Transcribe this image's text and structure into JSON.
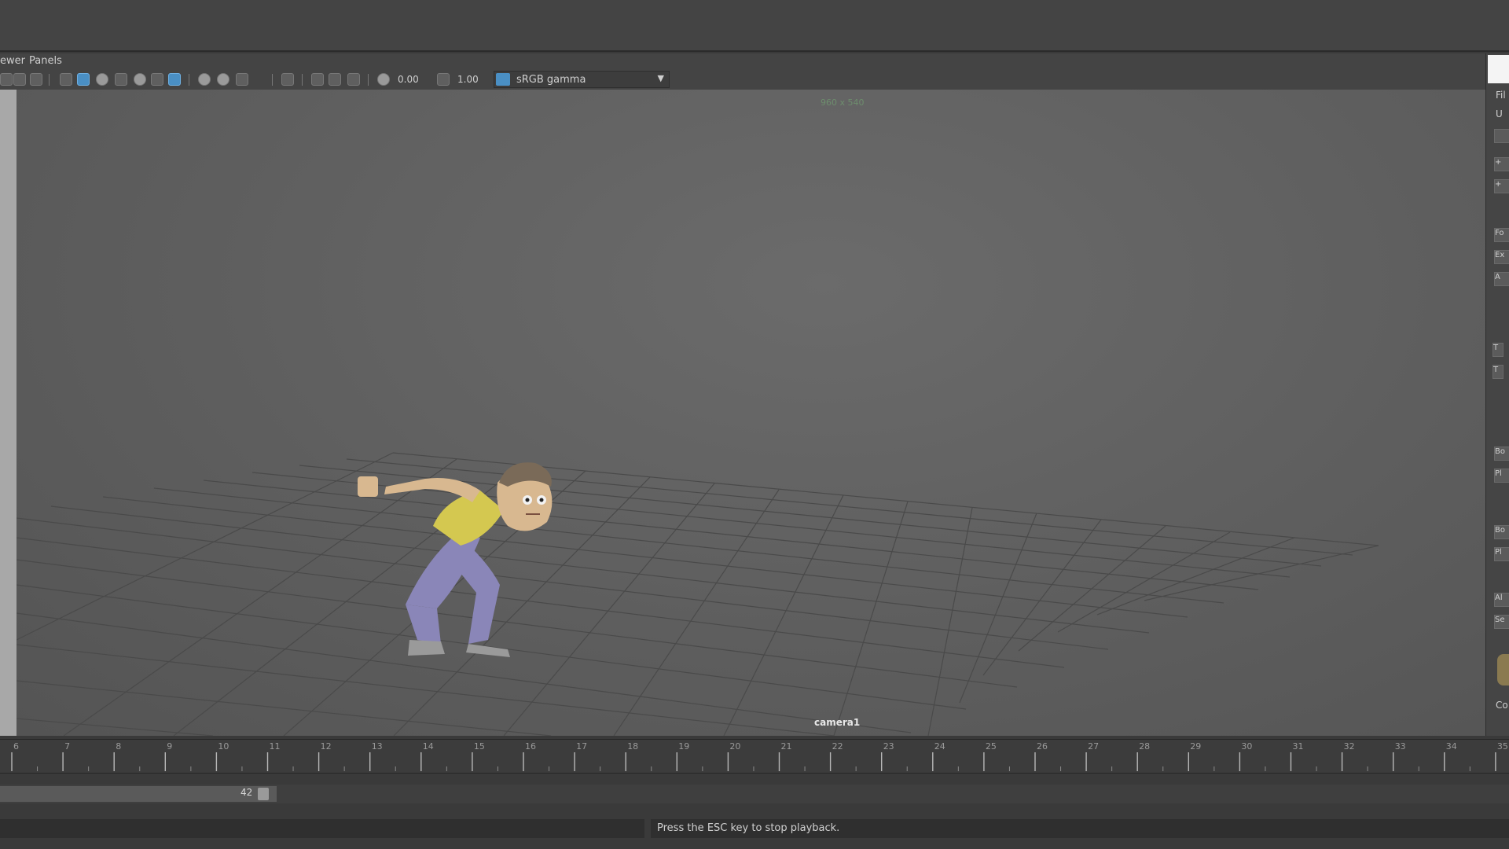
{
  "menu": {
    "item1": "ewer",
    "item2": "Panels"
  },
  "toolbar": {
    "exposure": "0.00",
    "gamma": "1.00",
    "color_space": "sRGB gamma",
    "icons": [
      "select-camera-icon",
      "camera-attributes-icon",
      "bookmark-icon",
      "image-plane-icon",
      "grid-icon",
      "film-gate-icon",
      "wireframe-icon",
      "smooth-shade-icon",
      "textured-icon",
      "lighting-icon",
      "shadows-icon",
      "ambient-occlusion-icon",
      "motion-blur-icon",
      "antialiasing-icon",
      "depth-of-field-icon",
      "isolate-select-icon",
      "xray-icon",
      "xray-joints-icon",
      "backface-icon",
      "exposure-icon",
      "gamma-icon",
      "color-management-icon"
    ]
  },
  "viewport": {
    "resolution_gate": "960 x 540",
    "camera_name": "camera1"
  },
  "right_panel": {
    "items": [
      "",
      "+",
      "+",
      "Fo",
      "Ex",
      "A",
      "T",
      "T",
      "Bo",
      "Pl",
      "Bo",
      "Pl",
      "Al",
      "Se"
    ],
    "labels": [
      "Fil",
      "U",
      "Co"
    ]
  },
  "timeline": {
    "start_tick": 6,
    "end_tick": 35,
    "ticks": [
      "6",
      "7",
      "8",
      "9",
      "10",
      "11",
      "12",
      "13",
      "14",
      "15",
      "16",
      "17",
      "18",
      "19",
      "20",
      "21",
      "22",
      "23",
      "24",
      "25",
      "26",
      "27",
      "28",
      "29",
      "30",
      "31",
      "32",
      "33",
      "34",
      "35"
    ]
  },
  "range": {
    "end_value": "42"
  },
  "help_line": {
    "message": "Press the ESC key to stop playback."
  },
  "colors": {
    "accent": "#4a8fc4",
    "viewport_bg": "#606060",
    "character_shirt": "#d4c850",
    "character_pants": "#8a86b8",
    "character_skin": "#d8b890"
  }
}
